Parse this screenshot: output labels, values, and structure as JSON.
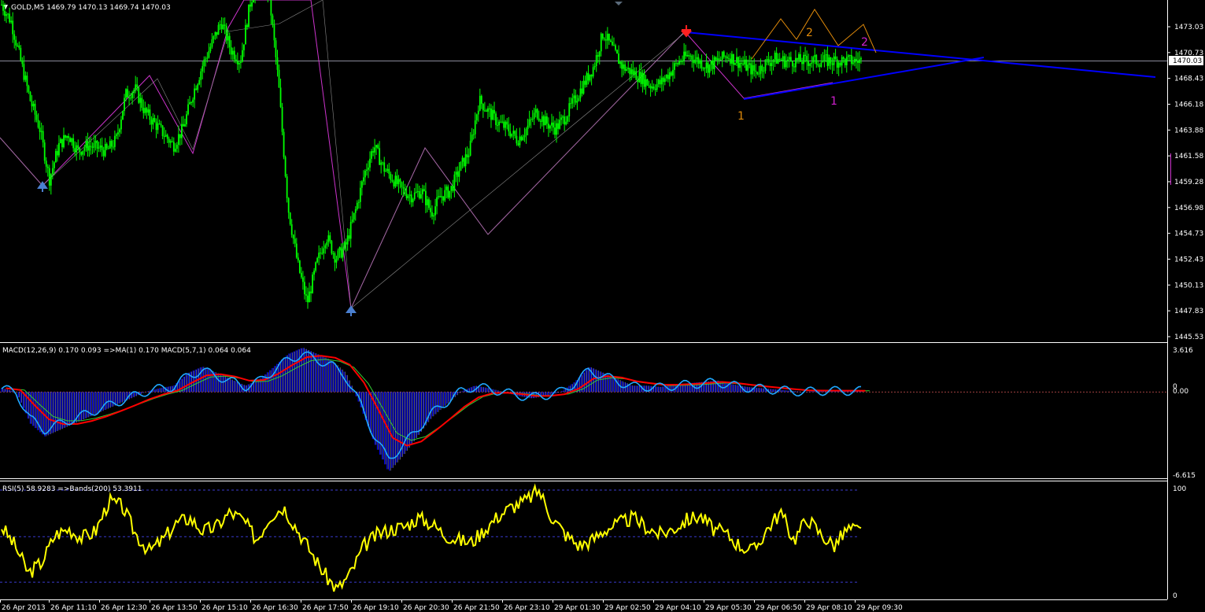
{
  "header": {
    "main": "GOLD,M5  1469.79 1470.13 1469.74 1470.03",
    "macd": "MACD(12,26,9) 0.170 0.093  =>MA(1) 0.170  MACD(5,7,1) 0.064 0.064",
    "rsi": "RSI(5) 58.9283  =>Bands(200) 53.3911"
  },
  "colors": {
    "background": "#000000",
    "candle": "#00ff00",
    "trendline": "#0000ff",
    "zigzag": "#cc33cc",
    "wave_orange": "#e08a0a",
    "wave_magenta": "#d020d0",
    "macd_red": "#ff0000",
    "macd_blue": "#1fa8ff",
    "macd_hist": "#0000dd",
    "rsi": "#ffff00",
    "bands": "#3b3bd0"
  },
  "price_axis": [
    "1473.03",
    "1470.73",
    "1468.43",
    "1466.18",
    "1463.88",
    "1461.58",
    "1459.28",
    "1456.98",
    "1454.73",
    "1452.43",
    "1450.13",
    "1447.83",
    "1445.53"
  ],
  "current_price": "1470.03",
  "macd_axis": [
    "3.616",
    "0",
    "0.00",
    "-6.615"
  ],
  "rsi_axis": [
    "100",
    "0"
  ],
  "time_axis": [
    "26 Apr 2013",
    "26 Apr 11:10",
    "26 Apr 12:30",
    "26 Apr 13:50",
    "26 Apr 15:10",
    "26 Apr 16:30",
    "26 Apr 17:50",
    "26 Apr 19:10",
    "26 Apr 20:30",
    "26 Apr 21:50",
    "26 Apr 23:10",
    "29 Apr 01:30",
    "29 Apr 02:50",
    "29 Apr 04:10",
    "29 Apr 05:30",
    "29 Apr 06:50",
    "29 Apr 08:10",
    "29 Apr 09:30"
  ],
  "wave_labels": [
    "1",
    "2",
    "1",
    "2"
  ],
  "chart_data": {
    "type": "line",
    "title": "GOLD,M5",
    "ylim": [
      1445.53,
      1475.0
    ],
    "series": [
      {
        "name": "GOLD",
        "x": [
          0,
          2,
          4,
          6,
          8,
          10,
          12,
          14,
          16,
          18,
          20,
          22,
          24,
          26,
          28,
          30,
          32,
          34,
          36,
          38,
          40,
          42,
          44,
          46,
          48,
          50,
          52,
          54,
          56,
          58,
          60,
          62,
          64,
          66,
          68,
          70,
          72,
          74,
          76,
          78,
          80,
          82,
          84,
          86,
          88,
          90,
          92,
          94,
          96,
          98,
          100,
          102,
          104,
          106,
          108,
          110,
          112,
          114,
          116,
          118,
          120,
          122,
          124,
          126,
          128,
          130,
          132,
          134,
          136,
          138,
          140,
          142,
          144,
          146,
          148,
          150,
          152,
          154,
          156,
          158,
          160,
          162,
          164,
          166,
          168,
          170,
          172,
          174,
          176,
          178,
          180
        ],
        "values": [
          1475.0,
          1473.5,
          1470.0,
          1466.5,
          1464.0,
          1459.5,
          1462.5,
          1463.5,
          1462.0,
          1462.5,
          1462.3,
          1462.0,
          1463.0,
          1467.0,
          1467.5,
          1465.5,
          1464.5,
          1463.5,
          1462.5,
          1464.0,
          1467.0,
          1469.5,
          1471.5,
          1473.5,
          1471.0,
          1470.0,
          1475.0,
          1478.0,
          1476.0,
          1468.0,
          1457.0,
          1452.0,
          1448.5,
          1452.0,
          1454.5,
          1452.5,
          1453.5,
          1456.5,
          1460.0,
          1462.5,
          1460.5,
          1459.5,
          1458.5,
          1458.0,
          1458.5,
          1456.5,
          1458.0,
          1458.5,
          1460.5,
          1462.0,
          1466.5,
          1465.5,
          1464.5,
          1464.0,
          1463.0,
          1464.0,
          1465.5,
          1464.5,
          1464.0,
          1465.0,
          1466.5,
          1468.0,
          1469.5,
          1472.5,
          1471.0,
          1469.5,
          1469.0,
          1468.5,
          1467.8,
          1468.0,
          1469.0,
          1470.0,
          1470.5,
          1470.0,
          1469.5,
          1470.0,
          1470.5,
          1470.0,
          1469.5,
          1469.0,
          1469.8,
          1470.2,
          1470.0,
          1470.0,
          1470.0,
          1470.0,
          1470.0,
          1470.0,
          1470.0,
          1470.0,
          1470.0
        ]
      }
    ],
    "macd_series": [
      0.3,
      0.0,
      -2.5,
      -3.5,
      -3.0,
      -2.5,
      -2.0,
      -1.5,
      -1.0,
      -0.5,
      0.0,
      0.3,
      0.5,
      1.5,
      2.0,
      1.5,
      1.0,
      0.5,
      1.0,
      2.0,
      3.0,
      3.5,
      3.0,
      2.5,
      1.5,
      -1.0,
      -4.0,
      -6.3,
      -5.0,
      -3.5,
      -2.0,
      -1.0,
      0.0,
      0.5,
      0.3,
      0.0,
      -0.3,
      -0.5,
      -0.3,
      0.0,
      0.8,
      2.0,
      1.5,
      1.0,
      0.5,
      0.5,
      0.4,
      0.6,
      0.7,
      0.8,
      0.9,
      0.6,
      0.4,
      0.3,
      0.2,
      0.1,
      0.0,
      0.1,
      0.1,
      0.1,
      0.1
    ],
    "rsi_series": [
      62,
      45,
      20,
      30,
      55,
      60,
      52,
      58,
      85,
      80,
      55,
      40,
      50,
      65,
      70,
      58,
      62,
      75,
      68,
      50,
      72,
      80,
      60,
      40,
      20,
      5,
      20,
      45,
      55,
      60,
      62,
      70,
      65,
      55,
      50,
      48,
      60,
      72,
      80,
      85,
      95,
      70,
      55,
      45,
      50,
      60,
      65,
      70,
      62,
      55,
      60,
      68,
      72,
      60,
      55,
      45,
      40,
      60,
      75,
      50,
      70,
      55,
      45,
      60,
      58
    ]
  }
}
